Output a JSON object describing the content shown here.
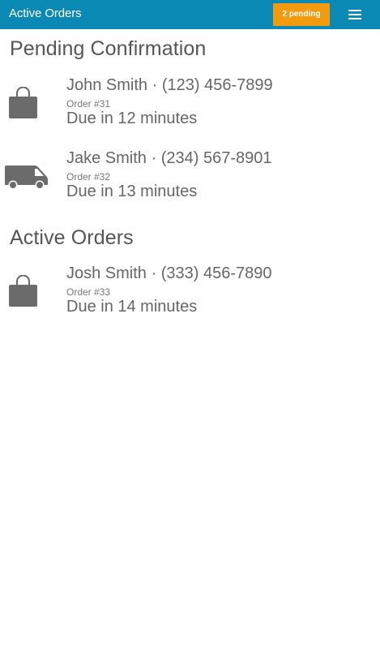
{
  "header": {
    "title": "Active Orders",
    "pending_badge": "2 pending",
    "menu_icon": "hamburger-menu-icon",
    "bar_color": "#0a89b5",
    "badge_color": "#f29b0f"
  },
  "sections": [
    {
      "title": "Pending Confirmation",
      "orders": [
        {
          "icon": "shopping-bag-icon",
          "name_phone": "John Smith · (123) 456-7899",
          "order_number": "Order #31",
          "due": "Due in 12 minutes"
        },
        {
          "icon": "delivery-van-icon",
          "name_phone": "Jake Smith · (234) 567-8901",
          "order_number": "Order #32",
          "due": "Due in 13 minutes"
        }
      ]
    },
    {
      "title": "Active Orders",
      "orders": [
        {
          "icon": "shopping-bag-icon",
          "name_phone": "Josh Smith · (333) 456-7890",
          "order_number": "Order #33",
          "due": "Due in 14 minutes"
        }
      ]
    }
  ]
}
